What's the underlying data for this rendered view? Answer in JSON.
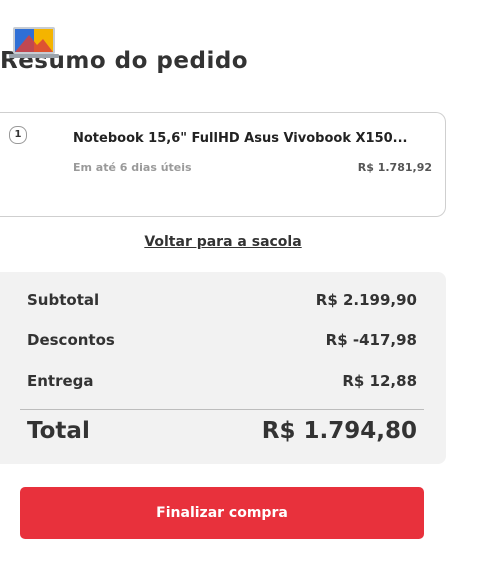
{
  "summary": {
    "title": "Resumo do pedido"
  },
  "item": {
    "quantity": "1",
    "name": "Notebook 15,6\" FullHD Asus Vivobook X150...",
    "delivery": "Em até 6 dias úteis",
    "price": "R$ 1.781,92",
    "image_icon": "laptop-thumbnail"
  },
  "back_link": "Voltar para a sacola",
  "totals": {
    "subtotal_label": "Subtotal",
    "subtotal_value": "R$ 2.199,90",
    "discounts_label": "Descontos",
    "discounts_value": "R$ -417,98",
    "delivery_label": "Entrega",
    "delivery_value": "R$ 12,88",
    "total_label": "Total",
    "total_value": "R$ 1.794,80"
  },
  "checkout_button": "Finalizar compra",
  "colors": {
    "accent": "#e8313c",
    "summary_bg": "#f2f2f2",
    "text": "#333333"
  }
}
